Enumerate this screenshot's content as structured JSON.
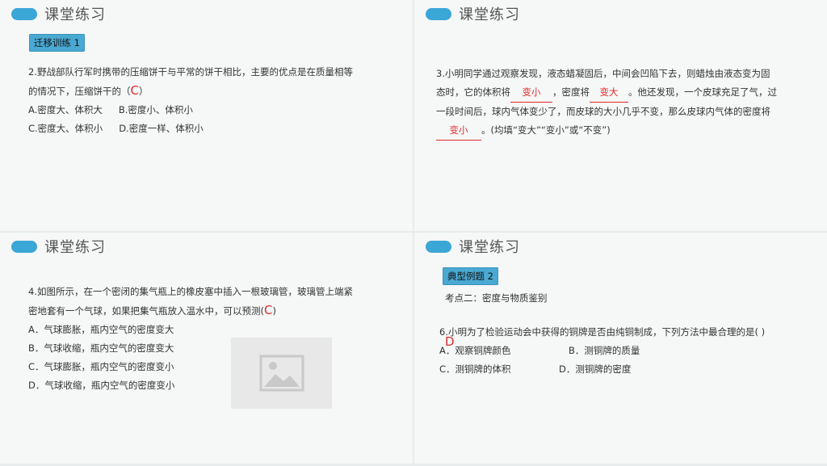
{
  "panel1": {
    "title": "课堂练习",
    "badge": "迁移训练 1",
    "question_a": "2.野战部队行军时携带的压缩饼干与平常的饼干相比，主要的优点是在质量相等",
    "question_b": "的情况下，压缩饼干的（",
    "answer": "C",
    "question_close": "）",
    "optA": "A.密度大、体积大",
    "optB": "B.密度小、体积小",
    "optC": "C.密度大、体积小",
    "optD": "D.密度一样、体积小"
  },
  "panel2": {
    "title": "课堂练习",
    "l1": "3.小明同学通过观察发现，液态蜡凝固后，中间会凹陷下去，则蜡烛由液态变为固",
    "l2_pre": "态时，它的体积将",
    "blank1": "变小",
    "l2_mid": "，密度将",
    "blank2": "变大",
    "l2_post": "。他还发现，一个皮球充足了气，过",
    "l3": "一段时间后，球内气体变少了，而皮球的大小几乎不变，那么皮球内气体的密度将",
    "blank3": "变小",
    "l4_post": "。(均填“变大”“变小”或“不变”)"
  },
  "panel3": {
    "title": "课堂练习",
    "l1": "4.如图所示，在一个密闭的集气瓶上的橡皮塞中插入一根玻璃管，玻璃管上端紧",
    "l2_pre": "密地套有一个气球，如果把集气瓶放入温水中，可以预测(",
    "answer": "C",
    "l2_close": ")",
    "optA": "A．气球膨胀，瓶内空气的密度变大",
    "optB": "B．气球收缩，瓶内空气的密度变大",
    "optC": "C．气球膨胀，瓶内空气的密度变小",
    "optD": "D．气球收缩，瓶内空气的密度变小",
    "image_icon": "image-placeholder-icon"
  },
  "panel4": {
    "title": "课堂练习",
    "badge": "典型例题 2",
    "topic": "考点二：密度与物质鉴别",
    "question": "6.小明为了检验运动会中获得的铜牌是否由纯铜制成，下列方法中最合理的是(     )",
    "answer": "D",
    "optA": "A．观察铜牌颜色",
    "optB": "B．测铜牌的质量",
    "optC": "C．测铜牌的体积",
    "optD": "D．测铜牌的密度"
  },
  "colors": {
    "accent": "#3aa7d6",
    "answer": "#e12b2b"
  }
}
